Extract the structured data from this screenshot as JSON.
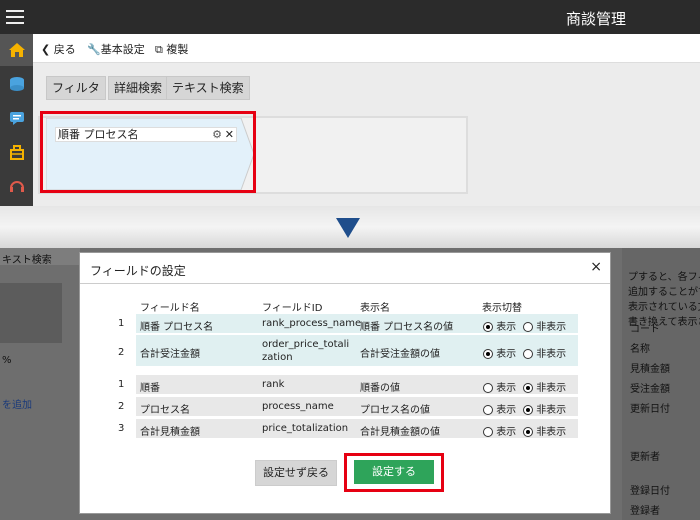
{
  "app": {
    "title": "商談管理"
  },
  "toolbar": {
    "back": "戻る",
    "basic": "基本設定",
    "copy": "複製"
  },
  "tabs": [
    "フィルタ",
    "詳細検索",
    "テキスト検索"
  ],
  "field_chip": {
    "label": "順番 プロセス名"
  },
  "background": {
    "left_tab": "キスト検索",
    "left_pct": "%",
    "left_link": "を追加",
    "right_texts": [
      "プすると、各フィ",
      "追加することがで",
      "表示されている文",
      "書き換えて表示さ"
    ],
    "right_labels": [
      "コード",
      "名称",
      "見積金額",
      "受注金額",
      "更新日付",
      "更新者",
      "登録日付",
      "登録者"
    ]
  },
  "modal": {
    "title": "フィールドの設定",
    "close": "×",
    "headers": {
      "name": "フィールド名",
      "id": "フィールドID",
      "display": "表示名",
      "toggle": "表示切替"
    },
    "shown_rows": [
      {
        "num": "1",
        "name": "順番 プロセス名",
        "id": "rank_process_name",
        "display": "順番 プロセス名の値",
        "state": "show"
      },
      {
        "num": "2",
        "name": "合計受注金額",
        "id": "order_price_totalization",
        "display": "合計受注金額の値",
        "state": "show"
      }
    ],
    "hidden_rows": [
      {
        "num": "1",
        "name": "順番",
        "id": "rank",
        "display": "順番の値",
        "state": "hide"
      },
      {
        "num": "2",
        "name": "プロセス名",
        "id": "process_name",
        "display": "プロセス名の値",
        "state": "hide"
      },
      {
        "num": "3",
        "name": "合計見積金額",
        "id": "price_totalization",
        "display": "合計見積金額の値",
        "state": "hide"
      }
    ],
    "radio_show": "表示",
    "radio_hide": "非表示",
    "cancel": "設定せず戻る",
    "ok": "設定する"
  },
  "colors": {
    "accent_green": "#2ea45a",
    "highlight_red": "#e60012",
    "row_shown": "#e0f0f1",
    "row_hidden": "#e8e8e8"
  }
}
